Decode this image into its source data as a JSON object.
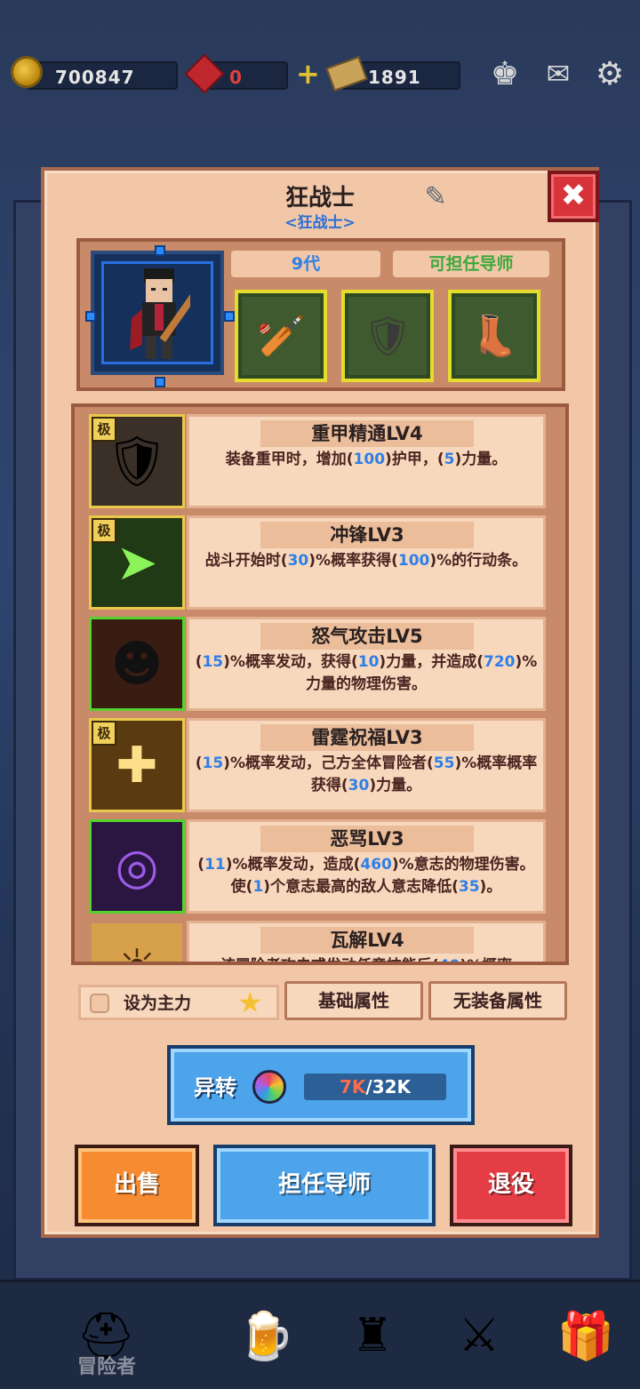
{
  "header": {
    "coins": "700847",
    "gems": "0",
    "tickets": "1891"
  },
  "hero": {
    "name": "狂战士",
    "class_tag": "<狂战士>",
    "generation": "9代",
    "mentor_status": "可担任导师"
  },
  "skills": [
    {
      "name": "重甲精通LV4",
      "desc": "装备重甲时，增加(100)护甲，(5)力量。",
      "badge": "极"
    },
    {
      "name": "冲锋LV3",
      "desc": "战斗开始时(30)%概率获得(100)%的行动条。",
      "badge": "极"
    },
    {
      "name": "怒气攻击LV5",
      "desc": "(15)%概率发动，获得(10)力量，并造成(720)%力量的物理伤害。",
      "badge": ""
    },
    {
      "name": "雷霆祝福LV3",
      "desc": "(15)%概率发动，己方全体冒险者(55)%概率概率获得(30)力量。",
      "badge": "极"
    },
    {
      "name": "恶骂LV3",
      "desc": "(11)%概率发动，造成(460)%意志的物理伤害。使(1)个意志最高的敌人意志降低(35)。",
      "badge": ""
    },
    {
      "name": "瓦解LV4",
      "desc": "该冒险者攻击或发动任意技能后(40)%概率",
      "badge": ""
    }
  ],
  "controls": {
    "set_main": "设为主力",
    "base_attr": "基础属性",
    "no_equip_attr": "无装备属性"
  },
  "transform": {
    "label": "异转",
    "cost_current": "7K",
    "cost_total": "/32K"
  },
  "actions": {
    "sell": "出售",
    "mentor": "担任导师",
    "retire": "退役"
  },
  "nav": {
    "adventurer": "冒险者"
  },
  "colors": {
    "accent_blue": "#2f7fe6",
    "mentor_green": "#3fa83f",
    "sell_orange": "#f78b32",
    "retire_red": "#e43d45"
  }
}
